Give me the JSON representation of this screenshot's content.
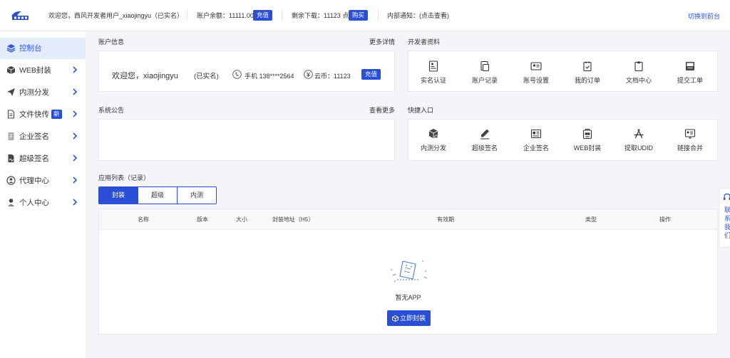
{
  "topbar": {
    "welcome": "欢迎您，西风开发者用户_xiaojingyu",
    "verified": "（已实名）",
    "balance_label": "账户余额：",
    "balance_value": "11111.00",
    "recharge_btn": "充值",
    "downloads_label": "剩余下载：",
    "downloads_value": "11123 点",
    "buy_btn": "购买",
    "notice": "内部通知：(点击查看)",
    "switch_link": "切换到前台",
    "accent": "#2a4fd6"
  },
  "sidebar": {
    "items": [
      {
        "label": "控制台",
        "icon": "layers-icon",
        "active": true
      },
      {
        "label": "WEB封装",
        "icon": "box-icon"
      },
      {
        "label": "内测分发",
        "icon": "send-icon"
      },
      {
        "label": "文件快传",
        "icon": "file-icon",
        "badge": "新"
      },
      {
        "label": "企业签名",
        "icon": "document-icon"
      },
      {
        "label": "超级签名",
        "icon": "signature-icon"
      },
      {
        "label": "代理中心",
        "icon": "agent-icon"
      },
      {
        "label": "个人中心",
        "icon": "user-icon"
      }
    ]
  },
  "account": {
    "title": "账户信息",
    "more": "更多详情",
    "welcome": "欢迎您，xiaojingyu",
    "verified": "(已实名)",
    "phone": "手机 138****2564",
    "coin": "云币：11123",
    "recharge_btn": "充值"
  },
  "developer": {
    "title": "开发者资料",
    "items": [
      {
        "label": "实名认证",
        "icon": "id-verify-icon"
      },
      {
        "label": "账户记录",
        "icon": "records-icon"
      },
      {
        "label": "账号设置",
        "icon": "account-card-icon"
      },
      {
        "label": "我的订单",
        "icon": "order-icon"
      },
      {
        "label": "文档中心",
        "icon": "clipboard-icon"
      },
      {
        "label": "提交工单",
        "icon": "ticket-icon"
      }
    ]
  },
  "announcement": {
    "title": "系统公告",
    "more": "查看更多"
  },
  "quick": {
    "title": "快捷入口",
    "items": [
      {
        "label": "内测分发",
        "icon": "distribute-icon"
      },
      {
        "label": "超级签名",
        "icon": "pen-icon"
      },
      {
        "label": "企业签名",
        "icon": "enterprise-icon"
      },
      {
        "label": "WEB封装",
        "icon": "package-icon"
      },
      {
        "label": "提取UDID",
        "icon": "app-store-icon"
      },
      {
        "label": "链接合并",
        "icon": "merge-icon"
      }
    ]
  },
  "apps": {
    "title": "应用列表（记录）",
    "tabs": [
      "封装",
      "超级",
      "内测"
    ],
    "active_tab": 0,
    "columns": [
      "名称",
      "版本",
      "大小",
      "封装地址（H5）",
      "有效期",
      "类型",
      "操作"
    ],
    "empty_text": "暂无APP",
    "empty_btn": "立即封装"
  },
  "float_panel": {
    "text": "联系我们"
  }
}
